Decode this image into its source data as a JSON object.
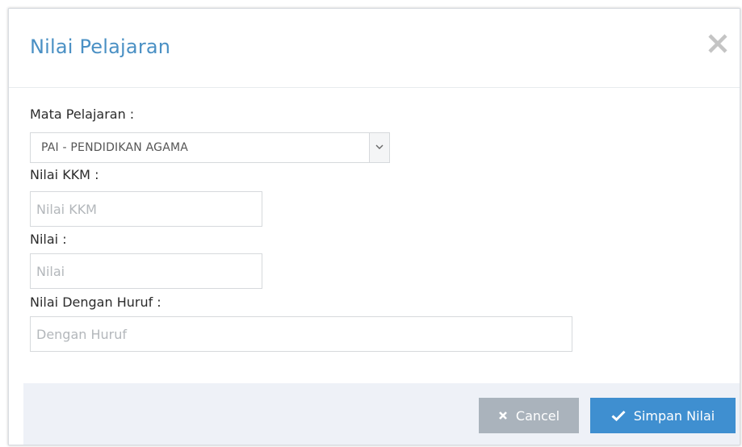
{
  "modal": {
    "title": "Nilai Pelajaran",
    "close_icon": "close-icon"
  },
  "form": {
    "subject": {
      "label": "Mata Pelajaran :",
      "selected": "PAI - PENDIDIKAN AGAMA"
    },
    "kkm": {
      "label": "Nilai KKM :",
      "placeholder": "Nilai KKM",
      "value": ""
    },
    "score": {
      "label": "Nilai :",
      "placeholder": "Nilai",
      "value": ""
    },
    "score_words": {
      "label": "Nilai Dengan Huruf :",
      "placeholder": "Dengan Huruf",
      "value": ""
    }
  },
  "footer": {
    "cancel_label": "Cancel",
    "cancel_icon": "times-icon",
    "save_label": "Simpan Nilai",
    "save_icon": "check-icon"
  },
  "colors": {
    "title": "#4a90c4",
    "cancel_button": "#aab3bc",
    "save_button": "#3f8fd0",
    "footer_bg": "#eef1f7"
  }
}
